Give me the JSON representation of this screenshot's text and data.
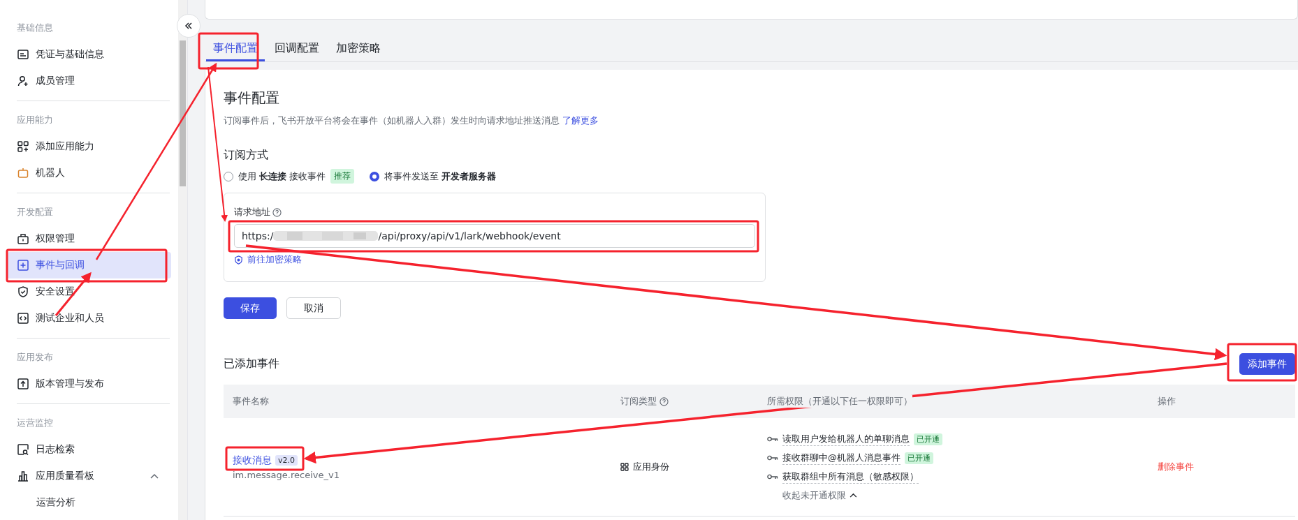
{
  "sidebar": {
    "sections": [
      {
        "title": "基础信息",
        "items": [
          {
            "label": "凭证与基础信息",
            "selected": false
          },
          {
            "label": "成员管理",
            "selected": false
          }
        ]
      },
      {
        "title": "应用能力",
        "items": [
          {
            "label": "添加应用能力",
            "selected": false
          },
          {
            "label": "机器人",
            "selected": false
          }
        ]
      },
      {
        "title": "开发配置",
        "items": [
          {
            "label": "权限管理",
            "selected": false
          },
          {
            "label": "事件与回调",
            "selected": true
          },
          {
            "label": "安全设置",
            "selected": false
          },
          {
            "label": "测试企业和人员",
            "selected": false
          }
        ]
      },
      {
        "title": "应用发布",
        "items": [
          {
            "label": "版本管理与发布",
            "selected": false
          }
        ]
      },
      {
        "title": "运营监控",
        "items": [
          {
            "label": "日志检索",
            "selected": false
          },
          {
            "label": "应用质量看板",
            "selected": false,
            "expanded": true,
            "children": [
              {
                "label": "运营分析",
                "selected": false
              }
            ]
          }
        ]
      }
    ]
  },
  "tabs": [
    {
      "label": "事件配置",
      "selected": true
    },
    {
      "label": "回调配置",
      "selected": false
    },
    {
      "label": "加密策略",
      "selected": false
    }
  ],
  "event_config": {
    "title": "事件配置",
    "description": "订阅事件后，飞书开放平台将会在事件（如机器人入群）发生时向请求地址推送消息",
    "learn_more_link": "了解更多",
    "subscription_heading": "订阅方式",
    "options": [
      {
        "text": "使用 **长连接** 接收事件",
        "badge": "推荐",
        "selected": false
      },
      {
        "text": "将事件发送至 **开发者服务器**",
        "selected": true
      }
    ],
    "request_url": {
      "label": "请求地址",
      "value_prefix": "https:/",
      "value_suffix": "/api/proxy/api/v1/lark/webhook/event"
    },
    "encryption_link": "前往加密策略",
    "save_button": "保存",
    "cancel_button": "取消"
  },
  "added_events": {
    "title": "已添加事件",
    "add_button": "添加事件",
    "columns": [
      {
        "label": "事件名称",
        "help": false
      },
      {
        "label": "订阅类型",
        "help": true
      },
      {
        "label": "所需权限（开通以下任一权限即可）",
        "help": false
      },
      {
        "label": "操作",
        "help": false
      }
    ],
    "rows": [
      {
        "name": "接收消息",
        "version": "v2.0",
        "event_key": "im.message.receive_v1",
        "subscription_type": "应用身份",
        "permissions": [
          {
            "label": "读取用户发给机器人的单聊消息",
            "badge": "已开通"
          },
          {
            "label": "接收群聊中@机器人消息事件",
            "badge": "已开通"
          },
          {
            "label": "获取群组中所有消息（敏感权限）"
          }
        ],
        "collapse_label": "收起未开通权限",
        "action": "删除事件"
      }
    ]
  }
}
